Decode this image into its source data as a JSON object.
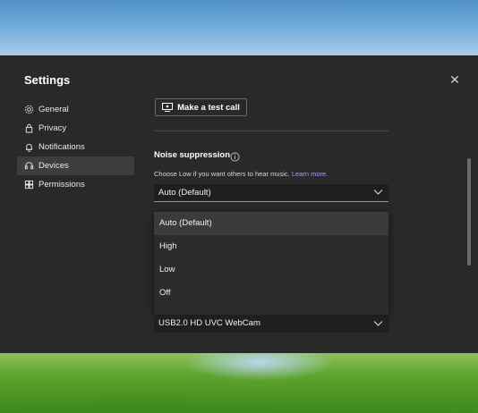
{
  "dialog": {
    "title": "Settings",
    "close_glyph": "✕"
  },
  "nav": {
    "items": [
      {
        "label": "General",
        "icon": "gear-icon"
      },
      {
        "label": "Privacy",
        "icon": "lock-icon"
      },
      {
        "label": "Notifications",
        "icon": "bell-icon"
      },
      {
        "label": "Devices",
        "icon": "headset-icon",
        "active": true
      },
      {
        "label": "Permissions",
        "icon": "grid-icon"
      }
    ]
  },
  "devices": {
    "test_call_label": "Make a test call",
    "noise_suppression": {
      "title": "Noise suppression",
      "description": "Choose Low if you want others to hear music.",
      "learn_more": "Learn more.",
      "selected": "Auto (Default)",
      "options": [
        "Auto (Default)",
        "High",
        "Low",
        "Off"
      ]
    },
    "camera": {
      "selected": "USB2.0 HD UVC WebCam"
    }
  },
  "colors": {
    "dialog_bg": "#292929",
    "accent_link": "#9ea2ff",
    "select_underline": "#8b8cc7"
  }
}
